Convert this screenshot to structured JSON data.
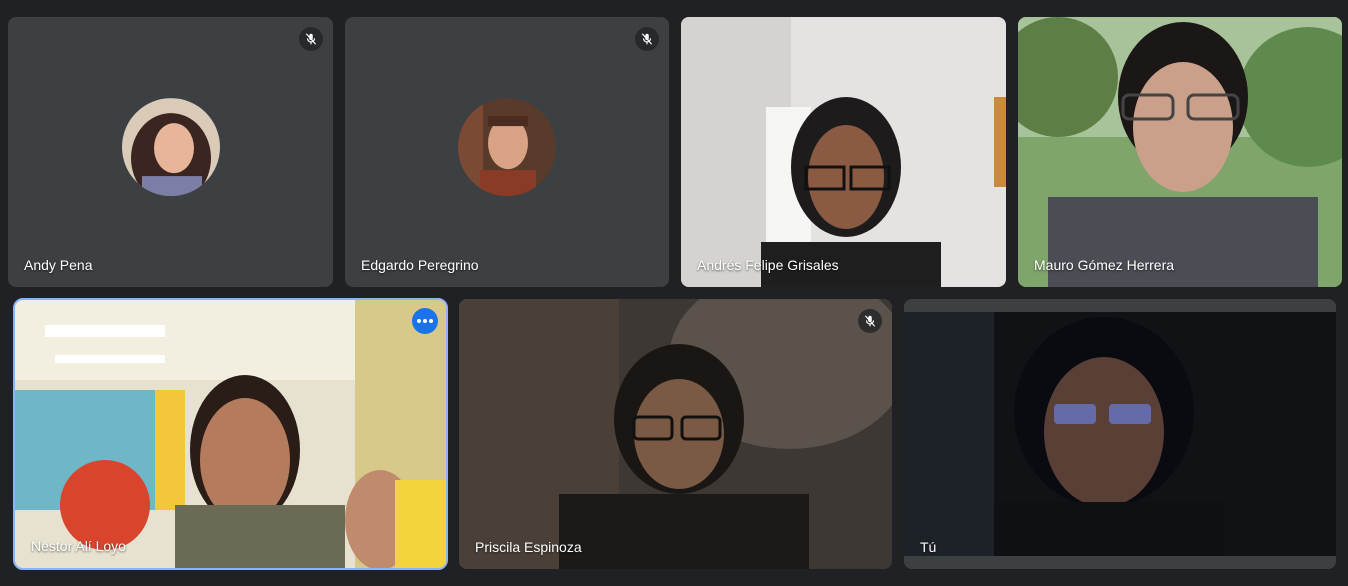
{
  "participants": [
    {
      "name": "Andy Pena",
      "muted": true,
      "video": false
    },
    {
      "name": "Edgardo Peregrino",
      "muted": true,
      "video": false
    },
    {
      "name": "Andrés Felipe Grisales",
      "muted": false,
      "video": true
    },
    {
      "name": "Mauro Gómez Herrera",
      "muted": false,
      "video": true
    },
    {
      "name": "Nestor Alí Loyo",
      "muted": false,
      "video": true,
      "pinned_options": true
    },
    {
      "name": "Priscila Espinoza",
      "muted": true,
      "video": true
    },
    {
      "name": "Tú",
      "muted": false,
      "video": true
    }
  ],
  "colors": {
    "background": "#202124",
    "tile": "#3c4043",
    "highlight": "#8ab4f8",
    "options_button": "#1a73e8"
  }
}
